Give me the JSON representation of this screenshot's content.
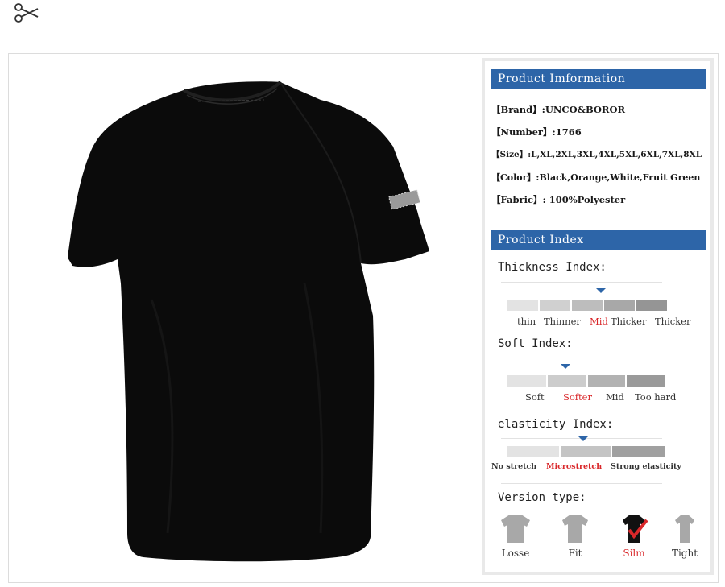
{
  "info": {
    "title": "Product Imformation",
    "rows": [
      "【Brand】:UNCO&BOROR",
      "【Number】:1766",
      "【Size】:L,XL,2XL,3XL,4XL,5XL,6XL,7XL,8XL",
      "【Color】:Black,Orange,White,Fruit Green",
      "【Fabric】: 100%Polyester"
    ]
  },
  "index": {
    "title": "Product Index",
    "thickness": {
      "label": "Thickness Index:",
      "options": [
        "thin",
        "Thinner",
        "Mid",
        "Thicker",
        "Thicker"
      ],
      "selected": 2
    },
    "soft": {
      "label": "Soft Index:",
      "options": [
        "Soft",
        "Softer",
        "Mid",
        "Too hard"
      ],
      "selected": 1
    },
    "elasticity": {
      "label": "elasticity Index:",
      "options": [
        "No stretch",
        "Microstretch",
        "Strong elasticity"
      ],
      "selected": 1
    },
    "version": {
      "label": "Version type:",
      "options": [
        "Losse",
        "Fit",
        "Silm",
        "Tight"
      ],
      "selected": 2
    }
  },
  "colors": {
    "accent": "#2d65a8",
    "selected_text": "#d9272a",
    "shirt": "#0b0b0b"
  }
}
